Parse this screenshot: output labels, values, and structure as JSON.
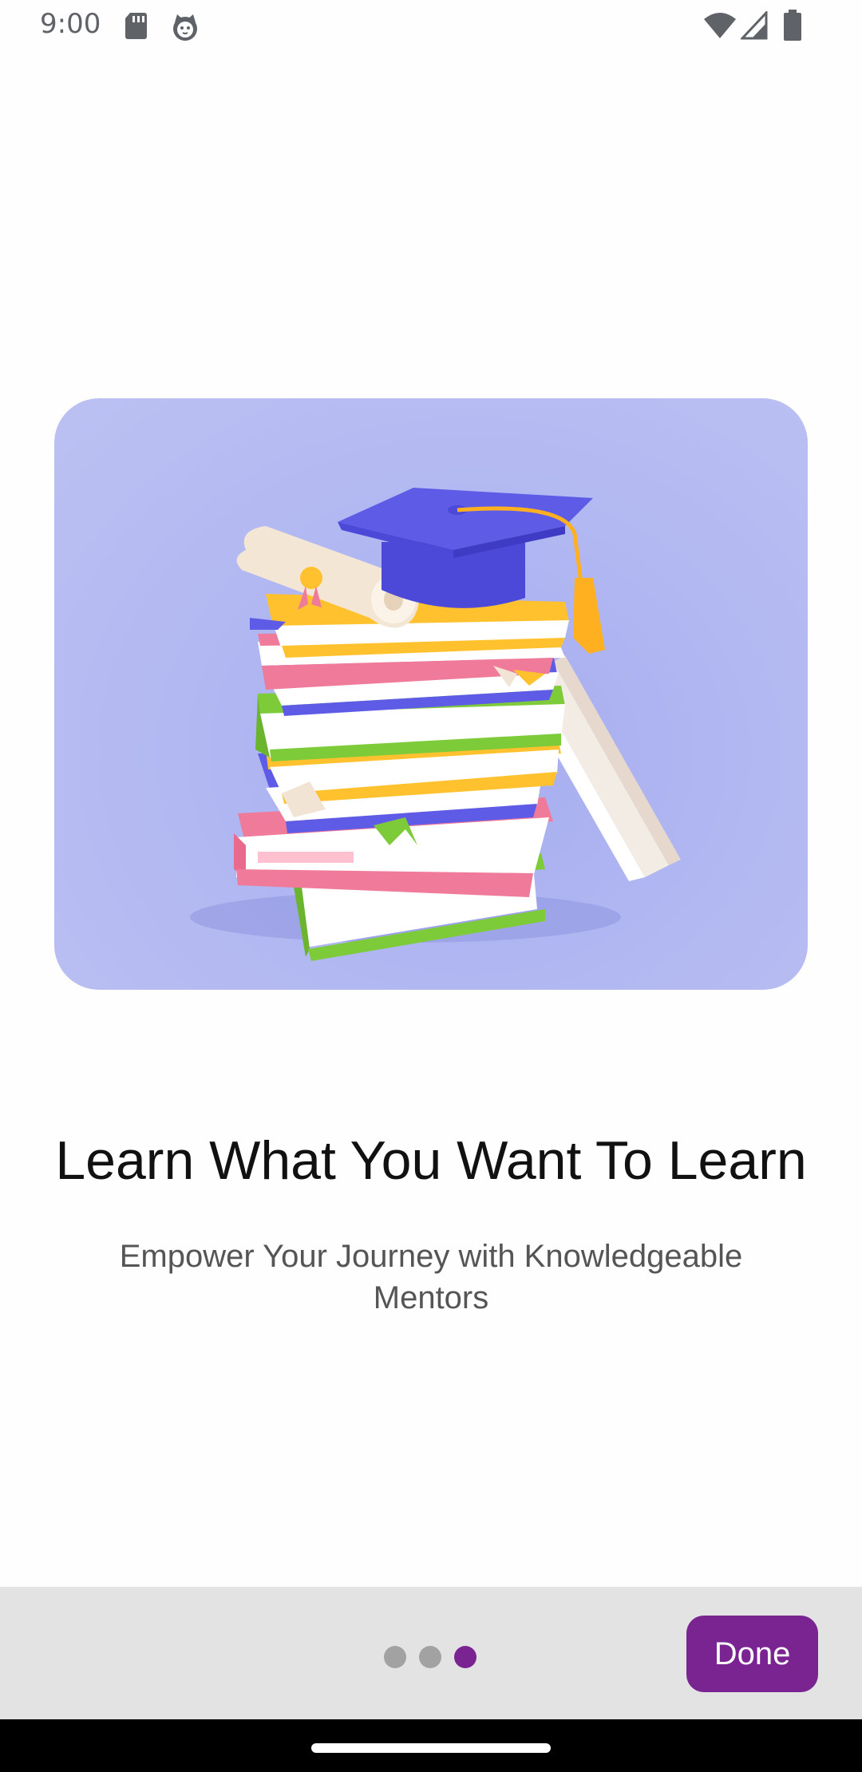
{
  "status_bar": {
    "time": "9:00",
    "icons": [
      "sd-card-icon",
      "cat-face-icon",
      "wifi-icon",
      "cell-signal-icon",
      "battery-icon"
    ]
  },
  "hero": {
    "illustration": "stack-of-books-graduation-cap-diploma",
    "background_color": "#b3b9f1"
  },
  "onboarding": {
    "title": "Learn What You Want To Learn",
    "subtitle": "Empower Your Journey with Knowledgeable Mentors"
  },
  "pager": {
    "page_count": 3,
    "current_page": 3
  },
  "actions": {
    "done_label": "Done"
  },
  "colors": {
    "accent": "#7a2491",
    "bottom_bar": "#e3e3e3",
    "dot_inactive": "#a2a2a2"
  }
}
